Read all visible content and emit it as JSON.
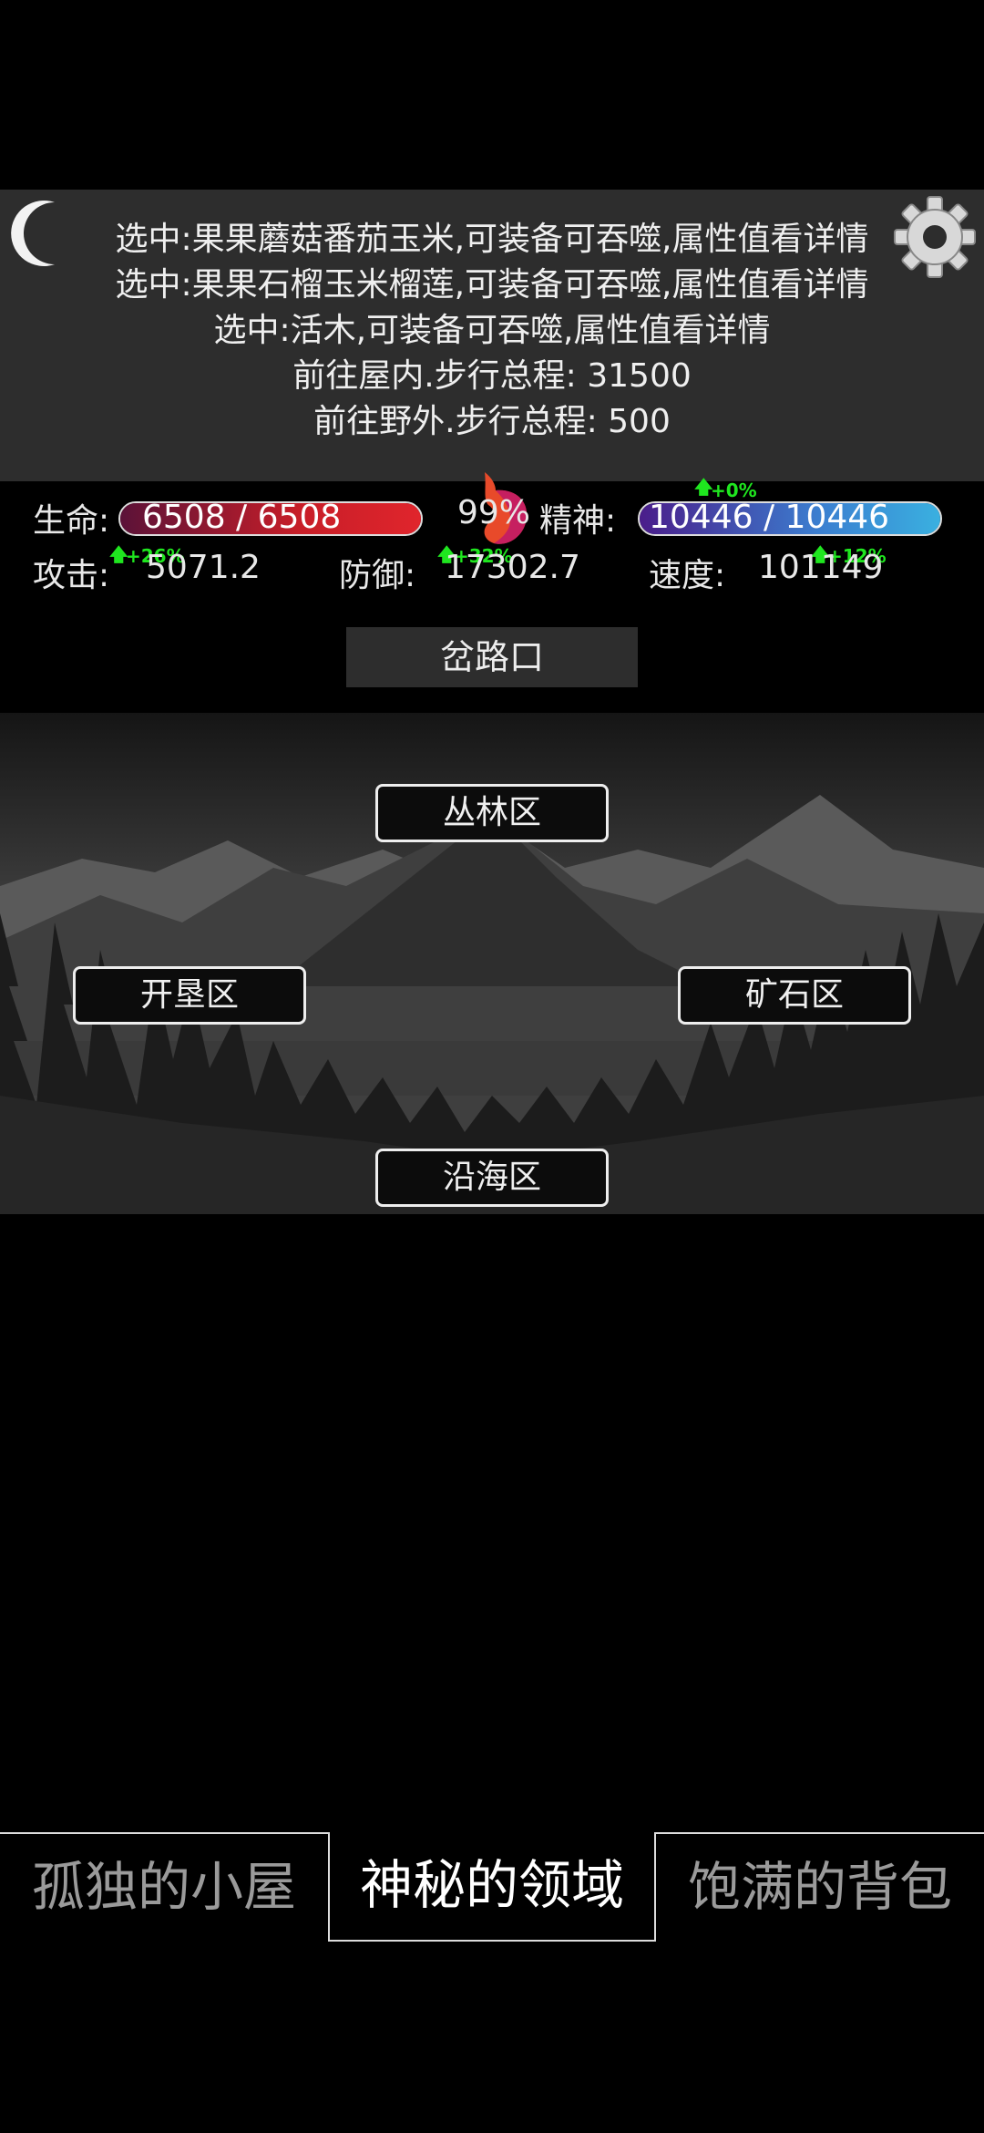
{
  "messages": [
    "选中:果果蘑菇番茄玉米,可装备可吞噬,属性值看详情",
    "选中:果果石榴玉米榴莲,可装备可吞噬,属性值看详情",
    "选中:活木,可装备可吞噬,属性值看详情",
    "前往屋内.步行总程: 31500",
    "前往野外.步行总程: 500"
  ],
  "stats": {
    "hp_label": "生命:",
    "hp_value": "6508 / 6508",
    "hp_fraction": 1.0,
    "hunger_percent": "99%",
    "spirit_label": "精神:",
    "spirit_value": "10446 / 10446",
    "spirit_fraction": 1.0,
    "spirit_gain": "+0%",
    "attack_label": "攻击:",
    "attack_value": "5071.2",
    "attack_gain": "+26%",
    "defense_label": "防御:",
    "defense_value": "17302.7",
    "defense_gain": "+32%",
    "speed_label": "速度:",
    "speed_value": "101149",
    "speed_gain": "+12%"
  },
  "location": "岔路口",
  "areas": {
    "north": "丛林区",
    "west": "开垦区",
    "east": "矿石区",
    "south": "沿海区"
  },
  "tabs": [
    {
      "label": "孤独的小屋",
      "active": false
    },
    {
      "label": "神秘的领域",
      "active": true
    },
    {
      "label": "饱满的背包",
      "active": false
    }
  ],
  "colors": {
    "hp_bar": "#c81e28",
    "spirit_bar": "#3b7fd0",
    "gain": "#1fe61f",
    "panel": "#2d2d2d"
  },
  "icons": [
    "moon-icon",
    "gear-icon",
    "stomach-icon"
  ]
}
